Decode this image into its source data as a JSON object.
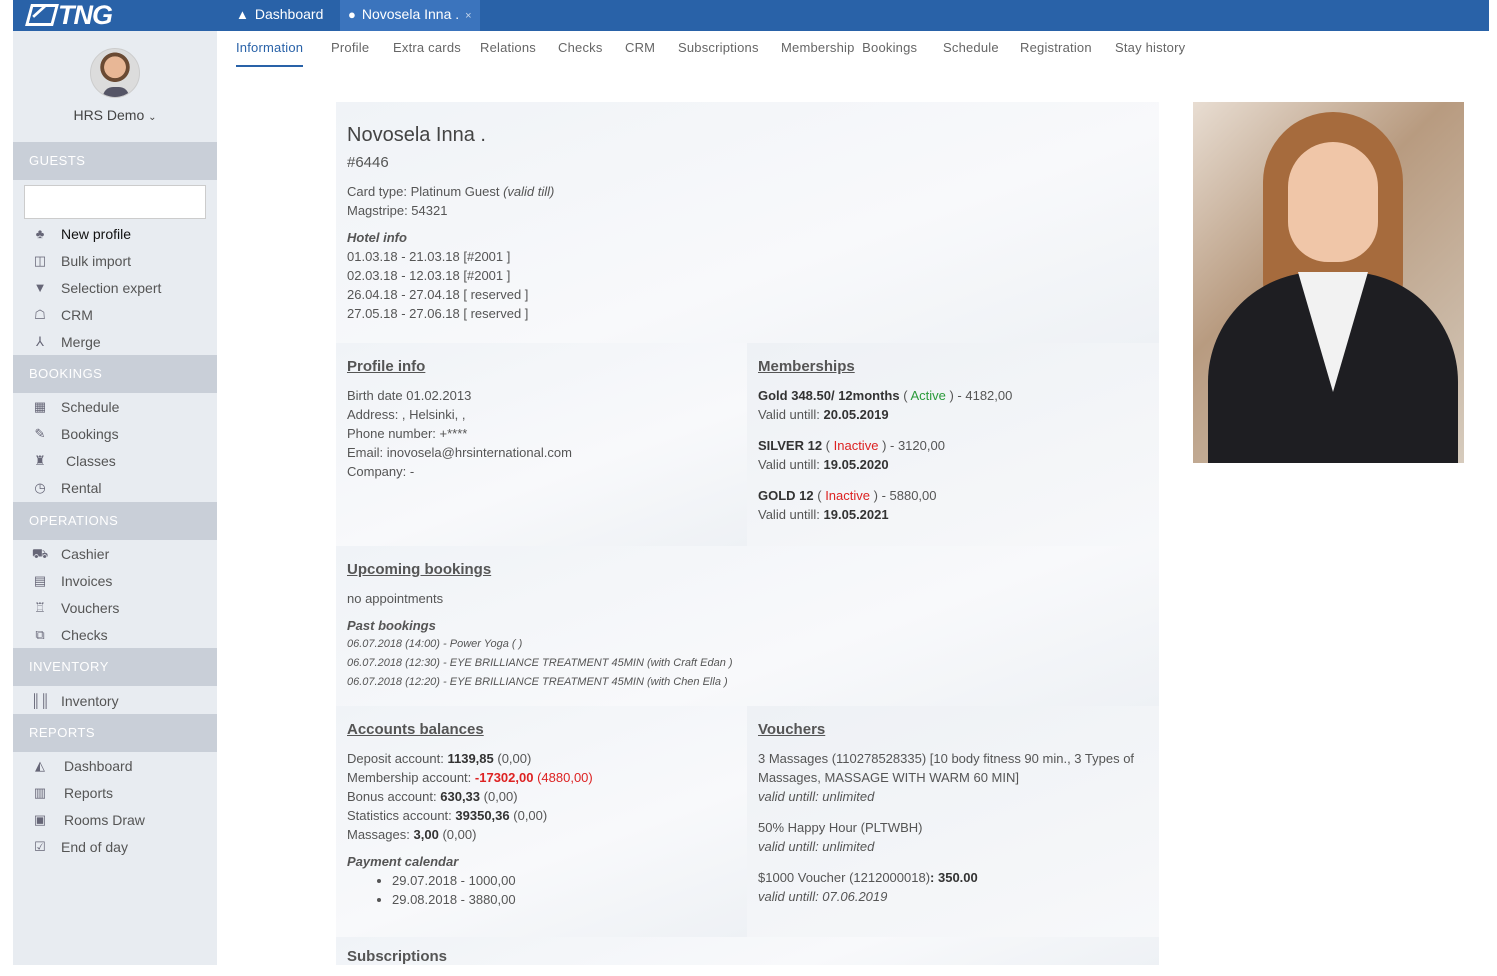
{
  "app": {
    "logo": "TNG"
  },
  "top_tabs": [
    {
      "label": "Dashboard"
    },
    {
      "label": "Novosela Inna ."
    }
  ],
  "user": {
    "name": "HRS Demo"
  },
  "sidebar": {
    "guests": "GUESTS",
    "guest_items": [
      "New profile",
      "Bulk import",
      "Selection expert",
      "CRM",
      "Merge"
    ],
    "bookings": "BOOKINGS",
    "booking_items": [
      "Schedule",
      "Bookings",
      "Classes",
      "Rental"
    ],
    "operations": "OPERATIONS",
    "operation_items": [
      "Cashier",
      "Invoices",
      "Vouchers",
      "Checks"
    ],
    "inventory": "INVENTORY",
    "inventory_items": [
      "Inventory"
    ],
    "reports": "REPORTS",
    "report_items": [
      "Dashboard",
      "Reports",
      "Rooms Draw",
      "End of day"
    ]
  },
  "subnav": [
    "Information",
    "Profile",
    "Extra cards",
    "Relations",
    "Checks",
    "CRM",
    "Subscriptions",
    "Membership  Bookings",
    "Schedule",
    "Registration",
    "Stay history"
  ],
  "guest": {
    "name": "Novosela Inna .",
    "number": "#6446",
    "card_type": "Card type: Platinum Guest",
    "valid_till": "(valid till)",
    "magstripe": "Magstripe: 54321",
    "hotel_info_title": "Hotel info",
    "hotel_info": [
      "01.03.18 - 21.03.18 [#2001 ]",
      "02.03.18 - 12.03.18 [#2001 ]",
      "26.04.18 - 27.04.18 [ reserved ]",
      "27.05.18 - 27.06.18 [ reserved ]"
    ]
  },
  "profile_info": {
    "title": "Profile info",
    "lines": [
      "Birth date 01.02.2013",
      "Address: , Helsinki, ,",
      "Phone number: +****",
      "Email: inovosela@hrsinternational.com",
      "Company: -"
    ]
  },
  "memberships": {
    "title": "Memberships",
    "items": [
      {
        "name": "Gold 348.50/ 12months",
        "status": "Active",
        "amount": ") - 4182,00",
        "valid_label": "Valid untill:",
        "valid": "20.05.2019"
      },
      {
        "name": "SILVER 12",
        "status": "Inactive",
        "amount": ") - 3120,00",
        "valid_label": "Valid untill:",
        "valid": "19.05.2020"
      },
      {
        "name": "GOLD 12",
        "status": "Inactive",
        "amount": ") - 5880,00",
        "valid_label": "Valid untill:",
        "valid": "19.05.2021"
      }
    ]
  },
  "upcoming": {
    "title": "Upcoming bookings",
    "none": "no appointments",
    "past_title": "Past bookings",
    "past": [
      "06.07.2018 (14:00) - Power Yoga ( )",
      "06.07.2018 (12:30) - EYE BRILLIANCE TREATMENT 45MIN (with Craft Edan )",
      "06.07.2018 (12:20) - EYE BRILLIANCE TREATMENT 45MIN (with Chen Ella )"
    ]
  },
  "accounts": {
    "title": "Accounts balances",
    "rows": [
      {
        "label": "Deposit account:",
        "value": "1139,85",
        "extra": "(0,00)"
      },
      {
        "label": "Membership account:",
        "value": "-17302,00",
        "extra": "(4880,00)"
      },
      {
        "label": "Bonus account:",
        "value": "630,33",
        "extra": "(0,00)"
      },
      {
        "label": "Statistics account:",
        "value": "39350,36",
        "extra": "(0,00)"
      },
      {
        "label": "Massages:",
        "value": "3,00",
        "extra": "(0,00)"
      }
    ],
    "payment_title": "Payment calendar",
    "payments": [
      "29.07.2018 - 1000,00",
      "29.08.2018 - 3880,00"
    ]
  },
  "vouchers": {
    "title": "Vouchers",
    "items": [
      {
        "text": "3 Massages (110278528335) [10 body fitness 90 min., 3 Types of Massages, MASSAGE WITH WARM 60 MIN]",
        "valid": "valid untill: unlimited"
      },
      {
        "text": "50% Happy Hour (PLTWBH)",
        "valid": "valid untill: unlimited"
      },
      {
        "text": "$1000 Voucher (1212000018)",
        "amount": ": 350.00",
        "valid": "valid untill: 07.06.2019"
      }
    ]
  },
  "subscriptions": {
    "title": "Subscriptions"
  }
}
